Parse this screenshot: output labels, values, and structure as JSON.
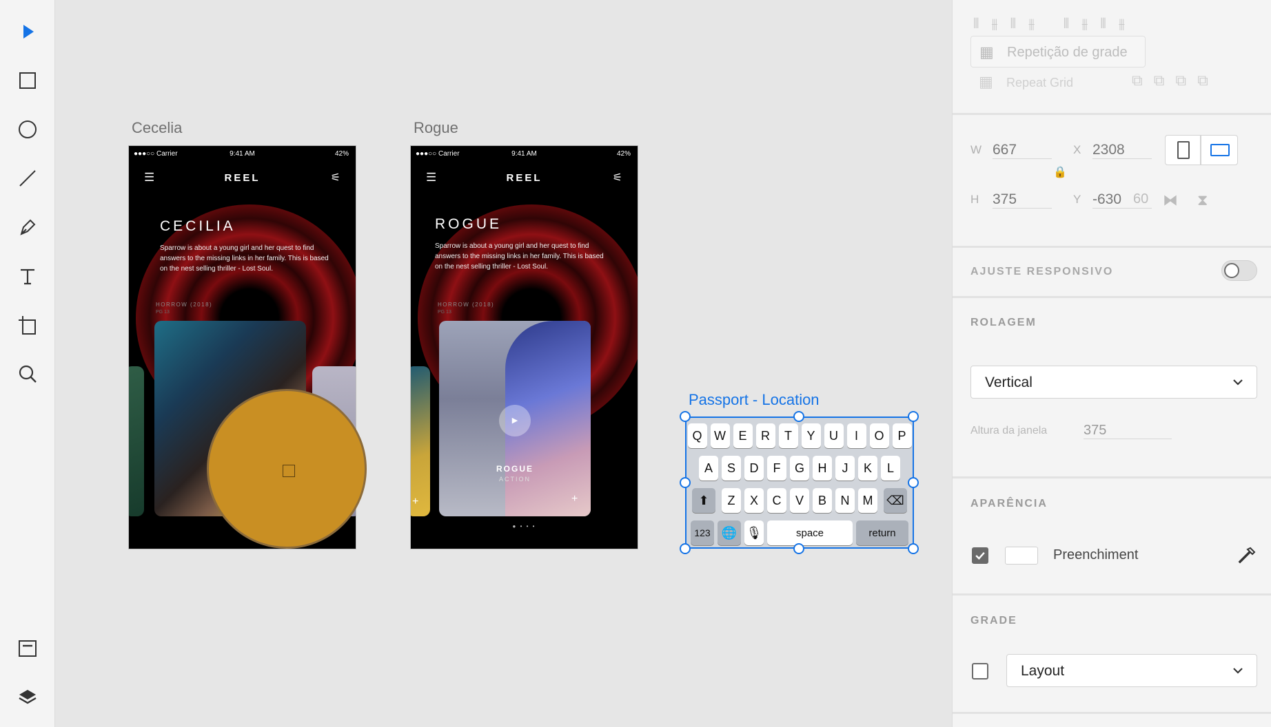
{
  "toolbar": {
    "tools": [
      {
        "name": "select-tool",
        "icon": "arrow-pointer-icon"
      },
      {
        "name": "rectangle-tool",
        "icon": "rectangle-icon"
      },
      {
        "name": "ellipse-tool",
        "icon": "ellipse-icon"
      },
      {
        "name": "line-tool",
        "icon": "line-icon"
      },
      {
        "name": "pen-tool",
        "icon": "pen-icon"
      },
      {
        "name": "text-tool",
        "icon": "text-icon"
      },
      {
        "name": "artboard-tool",
        "icon": "artboard-icon"
      },
      {
        "name": "zoom-tool",
        "icon": "magnifier-icon"
      }
    ],
    "bottom": [
      {
        "name": "assets-panel-button",
        "icon": "assets-icon"
      },
      {
        "name": "layers-panel-button",
        "icon": "layers-icon"
      }
    ]
  },
  "canvas": {
    "artboard1": {
      "title": "Cecelia",
      "status_left": "●●●○○ Carrier",
      "status_time": "9:41 AM",
      "status_right": "42%",
      "brand": "REEL",
      "movie_title": "CECILIA",
      "description": "Sparrow is about a young girl and her quest to find answers to the missing links in her family. This is based on the nest selling thriller - Lost Soul.",
      "genre": "HORROW (2018)",
      "rating": "PG 13"
    },
    "artboard2": {
      "title": "Rogue",
      "status_left": "●●●○○ Carrier",
      "status_time": "9:41 AM",
      "status_right": "42%",
      "brand": "REEL",
      "movie_title": "ROGUE",
      "description": "Sparrow is about a young girl and her quest to find answers to the missing links in her family. This is based on the nest selling thriller - Lost Soul.",
      "genre": "HORROW (2018)",
      "rating": "PG 13",
      "card_title": "ROGUE",
      "card_subtitle": "ACTION",
      "pager": "● • • •"
    },
    "keyboard": {
      "title": "Passport - Location",
      "row1": [
        "Q",
        "W",
        "E",
        "R",
        "T",
        "Y",
        "U",
        "I",
        "O",
        "P"
      ],
      "row2": [
        "A",
        "S",
        "D",
        "F",
        "G",
        "H",
        "J",
        "K",
        "L"
      ],
      "row3": [
        "Z",
        "X",
        "C",
        "V",
        "B",
        "N",
        "M"
      ],
      "numbers_key": "123",
      "space_key": "space",
      "return_key": "return"
    },
    "overlay_color": "#c98f23"
  },
  "panel": {
    "repeat_grid_pt": "Repetição de grade",
    "repeat_grid_en": "Repeat Grid",
    "w_label": "W",
    "w_value": "667",
    "x_label": "X",
    "x_value": "2308",
    "h_label": "H",
    "h_value": "375",
    "y_label": "Y",
    "y_value": "-630",
    "y_ghost": "60",
    "responsive_label": "AJUSTE RESPONSIVO",
    "scrolling_label": "ROLAGEM",
    "scroll_value": "Vertical",
    "viewport_label": "Altura da janela",
    "viewport_value": "375",
    "appearance_label": "APARÊNCIA",
    "fill_label": "Preenchiment",
    "grid_label": "GRADE",
    "grid_value": "Layout",
    "accent": "#1473e6"
  }
}
